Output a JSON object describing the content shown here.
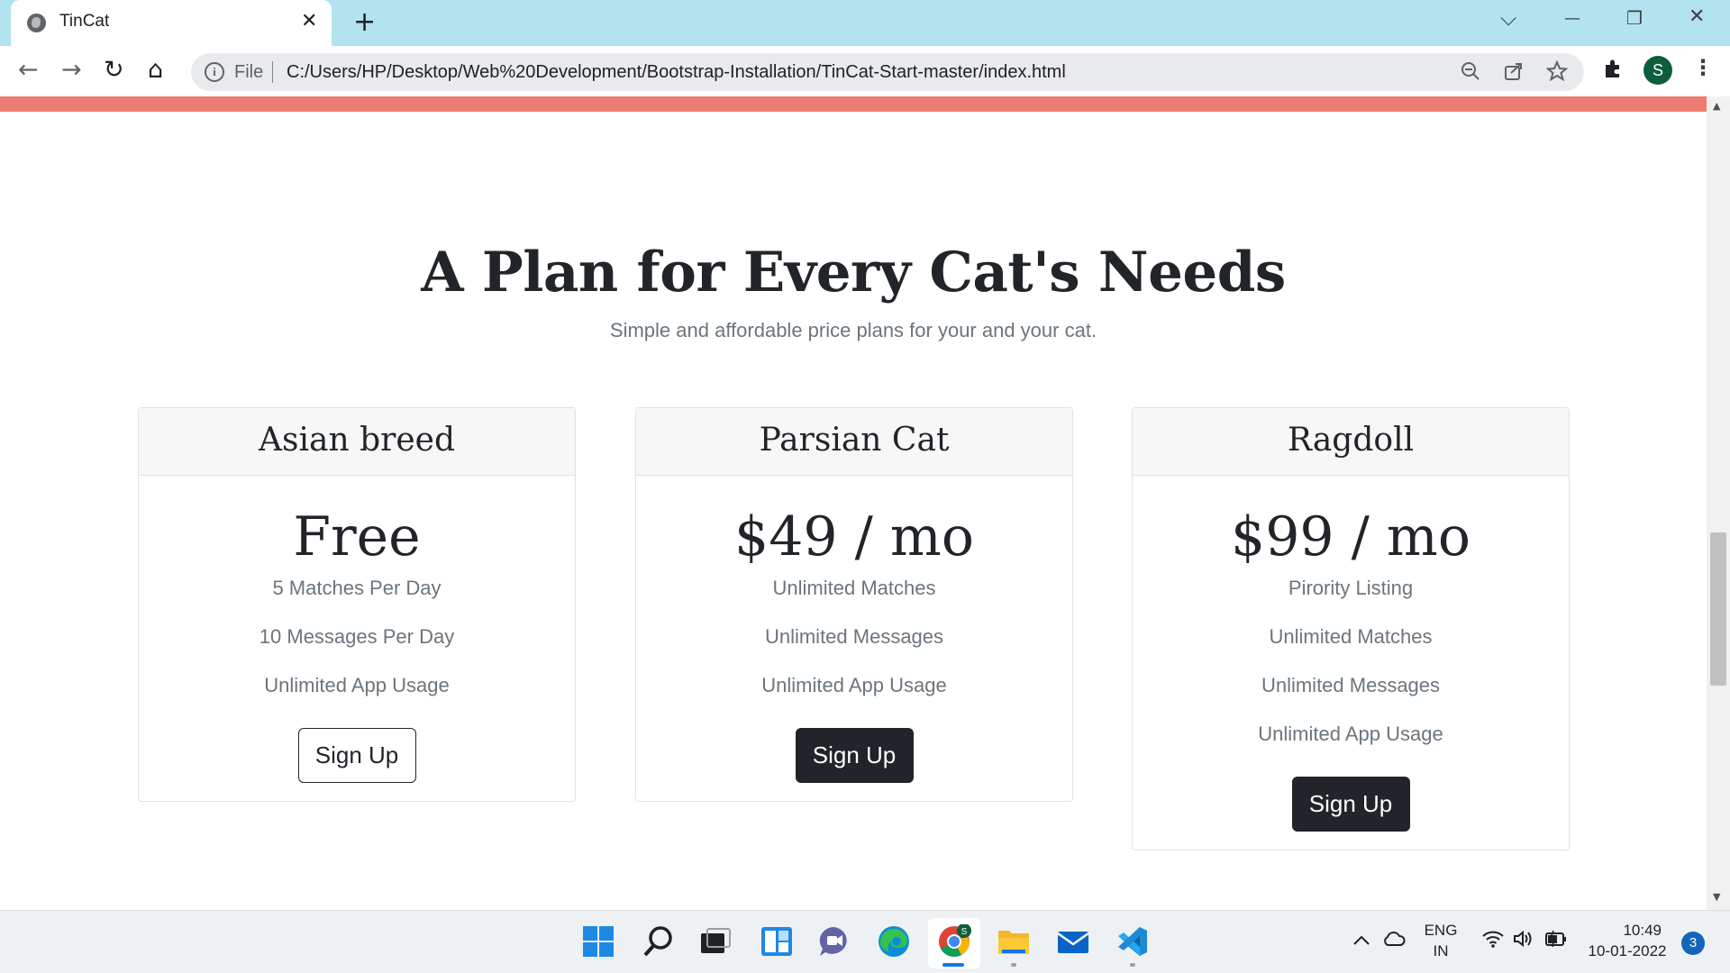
{
  "browser": {
    "tab_title": "TinCat",
    "tab_close": "✕",
    "new_tab": "+",
    "window_controls": {
      "tab_list": "⌵",
      "minimize": "—",
      "restore": "❐",
      "close": "✕"
    },
    "nav": {
      "back": "←",
      "forward": "→",
      "reload": "↻",
      "home": "⌂"
    },
    "address": {
      "scheme_label": "File",
      "url": "C:/Users/HP/Desktop/Web%20Development/Bootstrap-Installation/TinCat-Start-master/index.html"
    },
    "profile_initial": "S",
    "menu": "⋮"
  },
  "page": {
    "accent_color": "#ee7c73",
    "heading": "A Plan for Every Cat's Needs",
    "subheading": "Simple and affordable price plans for your and your cat.",
    "plans": [
      {
        "name": "Asian breed",
        "price": "Free",
        "features": [
          "5 Matches Per Day",
          "10 Messages Per Day",
          "Unlimited App Usage"
        ],
        "button": "Sign Up",
        "button_style": "outline"
      },
      {
        "name": "Parsian Cat",
        "price": "$49 / mo",
        "features": [
          "Unlimited Matches",
          "Unlimited Messages",
          "Unlimited App Usage"
        ],
        "button": "Sign Up",
        "button_style": "dark"
      },
      {
        "name": "Ragdoll",
        "price": "$99 / mo",
        "features": [
          "Pirority Listing",
          "Unlimited Matches",
          "Unlimited Messages",
          "Unlimited App Usage"
        ],
        "button": "Sign Up",
        "button_style": "dark"
      }
    ]
  },
  "taskbar": {
    "apps": [
      "windows-start-icon",
      "search-icon",
      "task-view-icon",
      "widgets-icon",
      "teams-chat-icon",
      "edge-icon",
      "chrome-icon",
      "file-explorer-icon",
      "mail-icon",
      "vscode-icon"
    ],
    "language": {
      "line1": "ENG",
      "line2": "IN"
    },
    "time": "10:49",
    "date": "10-01-2022",
    "notification_count": "3"
  }
}
